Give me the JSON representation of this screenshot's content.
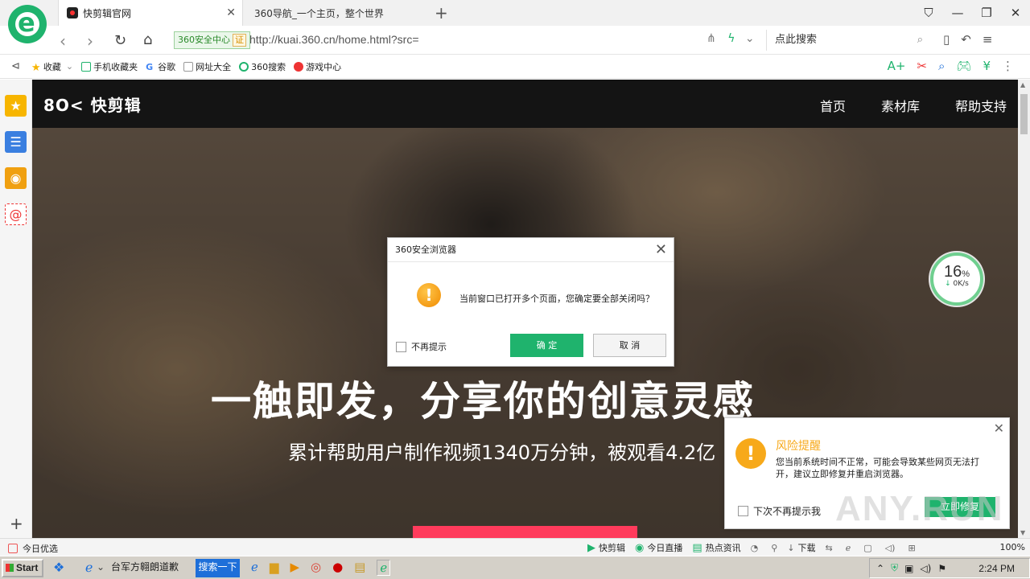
{
  "browser": {
    "tabs": [
      {
        "title": "快剪辑官网",
        "active": true
      },
      {
        "title": "360导航_一个主页，整个世界",
        "active": false
      }
    ],
    "ssl_badge": "360安全中心",
    "ssl_badge_mark": "证",
    "url": "http://kuai.360.cn/home.html?src=",
    "search_placeholder": "点此搜索",
    "bookmarks": [
      "收藏",
      "手机收藏夹",
      "谷歌",
      "网址大全",
      "360搜索",
      "游戏中心"
    ]
  },
  "site": {
    "logo": "8O< 快剪辑",
    "nav": [
      "首页",
      "素材库",
      "帮助支持"
    ],
    "hero_title": "一触即发，分享你的创意灵感",
    "hero_subtitle": "累计帮助用户制作视频1340万分钟，被观看4.2亿"
  },
  "speed_widget": {
    "percent": "16",
    "unit": "%",
    "rate": "0K/s"
  },
  "dialog": {
    "title": "360安全浏览器",
    "message": "当前窗口已打开多个页面，您确定要全部关闭吗？",
    "checkbox": "不再提示",
    "ok": "确 定",
    "cancel": "取 消"
  },
  "risk_popup": {
    "title": "风险提醒",
    "text": "您当前系统时间不正常，可能会导致某些网页无法打开，建议立即修复并重启浏览器。",
    "checkbox": "下次不再提示我",
    "button": "立即修复"
  },
  "watermark": "ANY.RUN",
  "statusbar": {
    "left": "今日优选",
    "items": [
      "快剪辑",
      "今日直播",
      "热点资讯",
      "下载"
    ],
    "zoom": "100%"
  },
  "taskbar": {
    "start": "Start",
    "window_title": "台军方翱朗道歉",
    "search": "搜索一下",
    "clock": "2:24 PM"
  },
  "colors": {
    "accent_green": "#1fb36d",
    "cta_pink": "#ff3b5c",
    "warn_orange": "#f7a91a"
  }
}
